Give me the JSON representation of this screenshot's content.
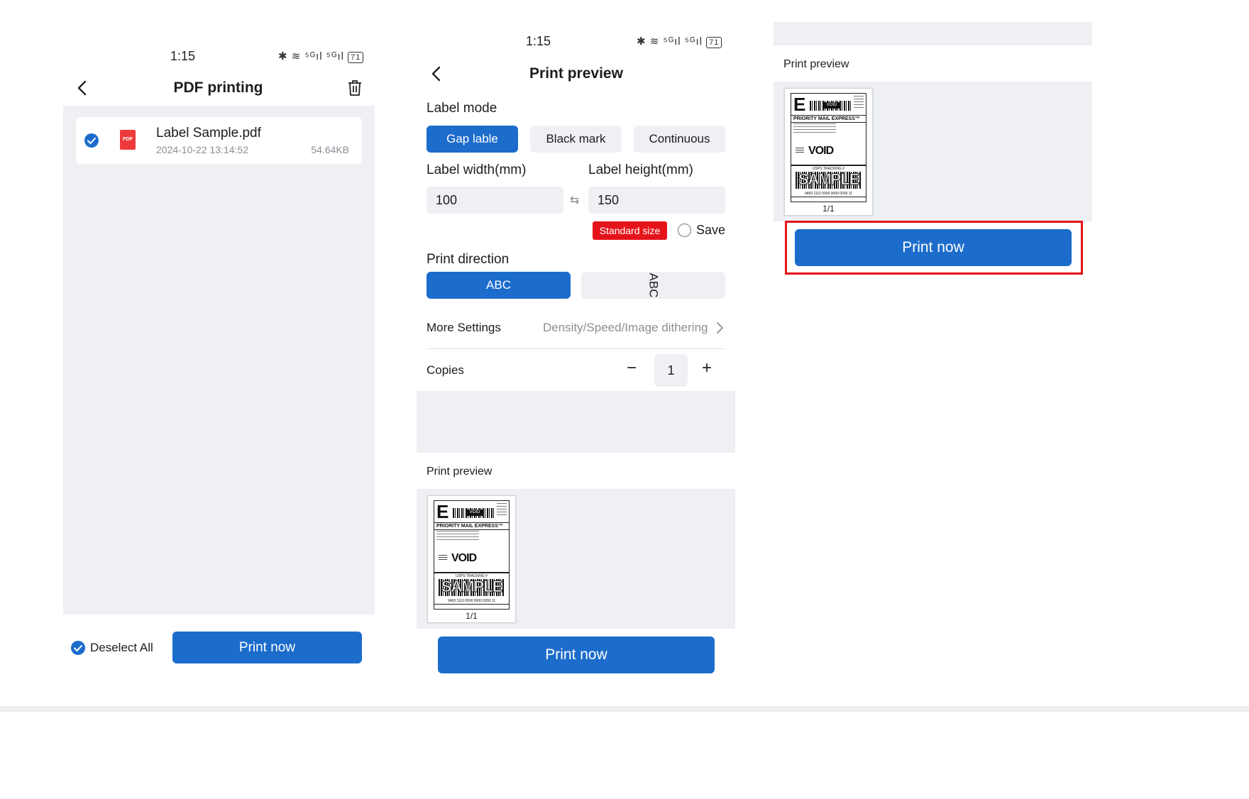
{
  "colors": {
    "accent": "#1c6ccc",
    "panel_bg": "#eef0f3",
    "badge_red": "#e5141b",
    "highlight_box": "#e3141b"
  },
  "screen1": {
    "status_time": "1:15",
    "status_icons": "✱ ≋ ⁵ᴳıl ⁵ᴳıl",
    "battery": "71",
    "title": "PDF printing",
    "back_icon": "chevron-left-icon",
    "trash_icon": "trash-icon",
    "file": {
      "name": "Label Sample.pdf",
      "date": "2024-10-22 13:14:52",
      "size": "54.64KB",
      "type_badge": "PDF"
    },
    "deselect_all": "Deselect All",
    "print_now": "Print now"
  },
  "screen2": {
    "status_time": "1:15",
    "status_icons": "✱ ≋ ⁵ᴳıl ⁵ᴳıl",
    "battery": "71",
    "title": "Print preview",
    "label_mode_heading": "Label mode",
    "label_modes": [
      "Gap lable",
      "Black mark",
      "Continuous"
    ],
    "selected_mode": "Gap lable",
    "label_width_label": "Label width(mm)",
    "label_height_label": "Label height(mm)",
    "label_width_value": "100",
    "label_height_value": "150",
    "standard_size": "Standard size",
    "save_label": "Save",
    "print_direction_heading": "Print direction",
    "directions": [
      "ABC",
      "ABC"
    ],
    "more_settings_label": "More Settings",
    "more_settings_value": "Density/Speed/Image dithering",
    "copies_label": "Copies",
    "copies_value": "1",
    "minus": "−",
    "plus": "+",
    "preview_heading": "Print preview",
    "print_now": "Print now"
  },
  "screen3": {
    "preview_heading": "Print preview",
    "print_now": "Print now"
  },
  "label_thumb": {
    "big_letter": "E",
    "void_tag": "VOID",
    "priority": "PRIORITY MAIL EXPRESS™",
    "void": "VOID",
    "tracking": "USPS TRACKING #",
    "sample": "SAMPLE",
    "number": "9400 1110 0000 0000 0000 11",
    "page": "1/1"
  }
}
